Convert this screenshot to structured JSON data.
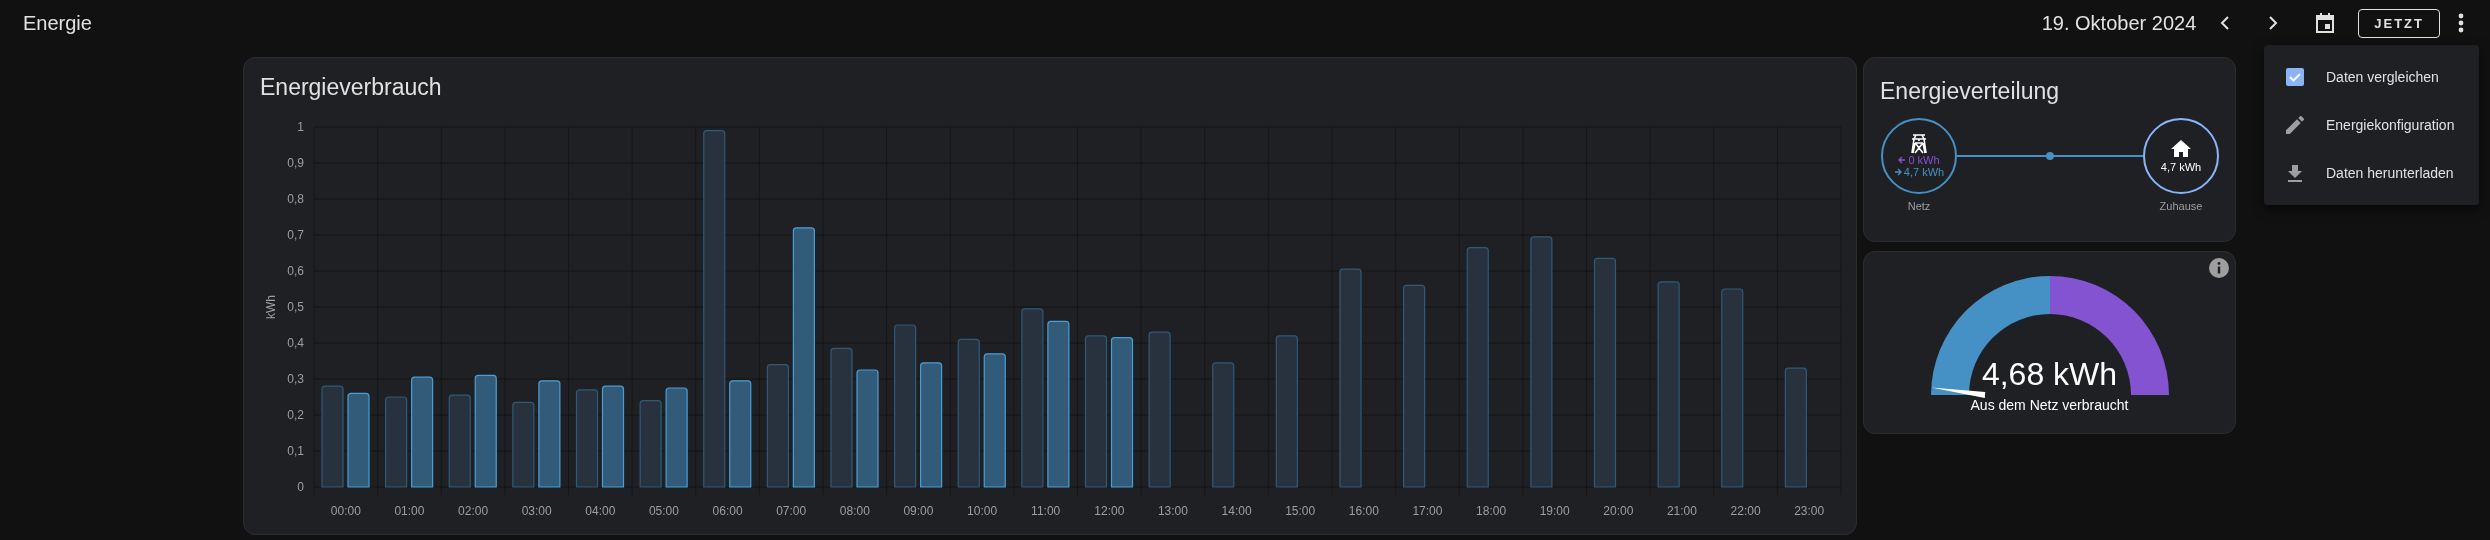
{
  "header": {
    "title": "Energie",
    "date": "19. Oktober 2024",
    "now_button": "JETZT"
  },
  "consumption": {
    "title": "Energieverbrauch",
    "chart_data": {
      "type": "bar",
      "grid": true,
      "ylabel": "kWh",
      "categories": [
        "00:00",
        "01:00",
        "02:00",
        "03:00",
        "04:00",
        "05:00",
        "06:00",
        "07:00",
        "08:00",
        "09:00",
        "10:00",
        "11:00",
        "12:00",
        "13:00",
        "14:00",
        "15:00",
        "16:00",
        "17:00",
        "18:00",
        "19:00",
        "20:00",
        "21:00",
        "22:00",
        "23:00"
      ],
      "ylim": [
        0,
        1
      ],
      "yticks": [
        0,
        {
          "value": 0.1,
          "label": "0,1"
        },
        {
          "value": 0.2,
          "label": "0,2"
        },
        {
          "value": 0.3,
          "label": "0,3"
        },
        {
          "value": 0.4,
          "label": "0,4"
        },
        {
          "value": 0.5,
          "label": "0,5"
        },
        {
          "value": 0.6,
          "label": "0,6"
        },
        {
          "value": 0.7,
          "label": "0,7"
        },
        {
          "value": 0.8,
          "label": "0,8"
        },
        {
          "value": 0.9,
          "label": "0,9"
        },
        1
      ],
      "series": [
        {
          "color": "#27323e",
          "values": [
            0.28,
            0.25,
            0.255,
            0.235,
            0.27,
            0.24,
            0.99,
            0.34,
            0.385,
            0.45,
            0.41,
            0.495,
            0.42,
            0.43,
            0.345,
            0.42,
            0.605,
            0.56,
            0.665,
            0.695,
            0.635,
            0.57,
            0.55,
            0.33
          ]
        },
        {
          "color": "#325a79",
          "values": [
            0.26,
            0.305,
            0.31,
            0.295,
            0.28,
            0.275,
            0.295,
            0.72,
            0.325,
            0.345,
            0.37,
            0.46,
            0.415,
            null,
            null,
            null,
            null,
            null,
            null,
            null,
            null,
            null,
            null,
            null
          ]
        }
      ]
    }
  },
  "distribution": {
    "title": "Energieverteilung",
    "grid": {
      "label": "Netz",
      "returned": "0 kWh",
      "consumed": "4,7 kWh"
    },
    "home": {
      "label": "Zuhause",
      "value": "4,7 kWh"
    }
  },
  "gauge": {
    "value": "4,68 kWh",
    "label": "Aus dem Netz verbraucht"
  },
  "menu": [
    {
      "kind": "checkbox",
      "label": "Daten vergleichen",
      "checked": true
    },
    {
      "kind": "edit",
      "label": "Energiekonfiguration"
    },
    {
      "kind": "download",
      "label": "Daten herunterladen"
    }
  ]
}
